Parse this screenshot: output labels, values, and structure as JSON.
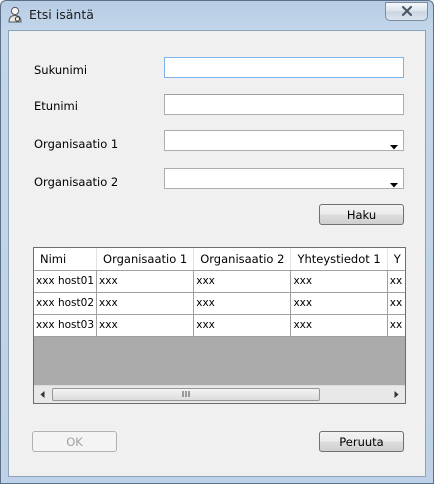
{
  "window": {
    "title": "Etsi isäntä"
  },
  "form": {
    "surname_label": "Sukunimi",
    "surname_value": "",
    "firstname_label": "Etunimi",
    "firstname_value": "",
    "org1_label": "Organisaatio 1",
    "org1_value": "",
    "org2_label": "Organisaatio 2",
    "org2_value": ""
  },
  "search_button": "Haku",
  "grid": {
    "columns": [
      "Nimi",
      "Organisaatio 1",
      "Organisaatio 2",
      "Yhteystiedot 1",
      "Y"
    ],
    "rows": [
      [
        "xxx host01",
        "xxx",
        "xxx",
        "xxx",
        "xx"
      ],
      [
        "xxx host02",
        "xxx",
        "xxx",
        "xxx",
        "xx"
      ],
      [
        "xxx host03",
        "xxx",
        "xxx",
        "xxx",
        "xx"
      ]
    ]
  },
  "ok_button": "OK",
  "cancel_button": "Peruuta",
  "icons": {
    "title": "user-search-icon",
    "close": "close-icon",
    "dropdown": "chevron-down-icon",
    "scroll_left": "arrow-left-icon",
    "scroll_right": "arrow-right-icon"
  }
}
